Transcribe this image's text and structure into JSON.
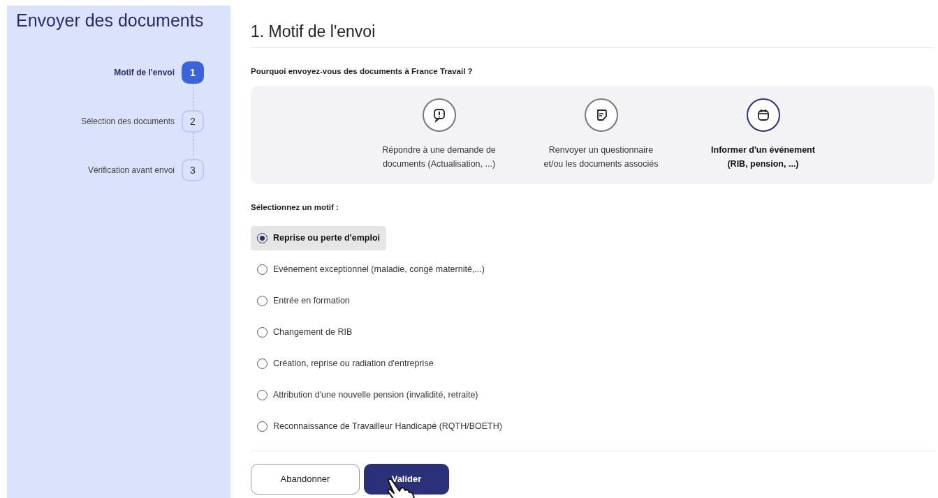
{
  "sidebar": {
    "title": "Envoyer des documents",
    "steps": [
      {
        "number": "1",
        "label": "Motif de l'envoi",
        "selected": true
      },
      {
        "number": "2",
        "label": "Sélection des documents",
        "selected": false
      },
      {
        "number": "3",
        "label": "Vérification avant envoi",
        "selected": false
      }
    ]
  },
  "heading": "1. Motif de l'envoi",
  "question": "Pourquoi envoyez-vous des documents à France Travail ?",
  "categories": [
    {
      "kind": "alert",
      "lines": [
        "Répondre à une demande de",
        "documents (Actualisation, ...)"
      ],
      "selected": false
    },
    {
      "kind": "document",
      "lines": [
        "Renvoyer un questionnaire",
        "et/ou les documents associés"
      ],
      "selected": false
    },
    {
      "kind": "calendar",
      "lines": [
        "Informer d'un événement",
        "(RIB, pension, ...)"
      ],
      "selected": true
    }
  ],
  "motif_label": "Sélectionnez un motif :",
  "motifs": [
    {
      "label": "Reprise ou perte d'emploi",
      "selected": true
    },
    {
      "label": "Evénement exceptionnel (maladie, congé maternité,...)",
      "selected": false
    },
    {
      "label": "Entrée en formation",
      "selected": false
    },
    {
      "label": "Changement de RIB",
      "selected": false
    },
    {
      "label": "Création, reprise ou radiation d'entreprise",
      "selected": false
    },
    {
      "label": "Attribution d'une nouvelle pension (invalidité, retraite)",
      "selected": false
    },
    {
      "label": "Reconnaissance de Travailleur Handicapé (RQTH/BOETH)",
      "selected": false
    }
  ],
  "buttons": [
    {
      "kind": "secondary",
      "label": "Abandonner"
    },
    {
      "kind": "primary",
      "label": "Valider"
    }
  ]
}
